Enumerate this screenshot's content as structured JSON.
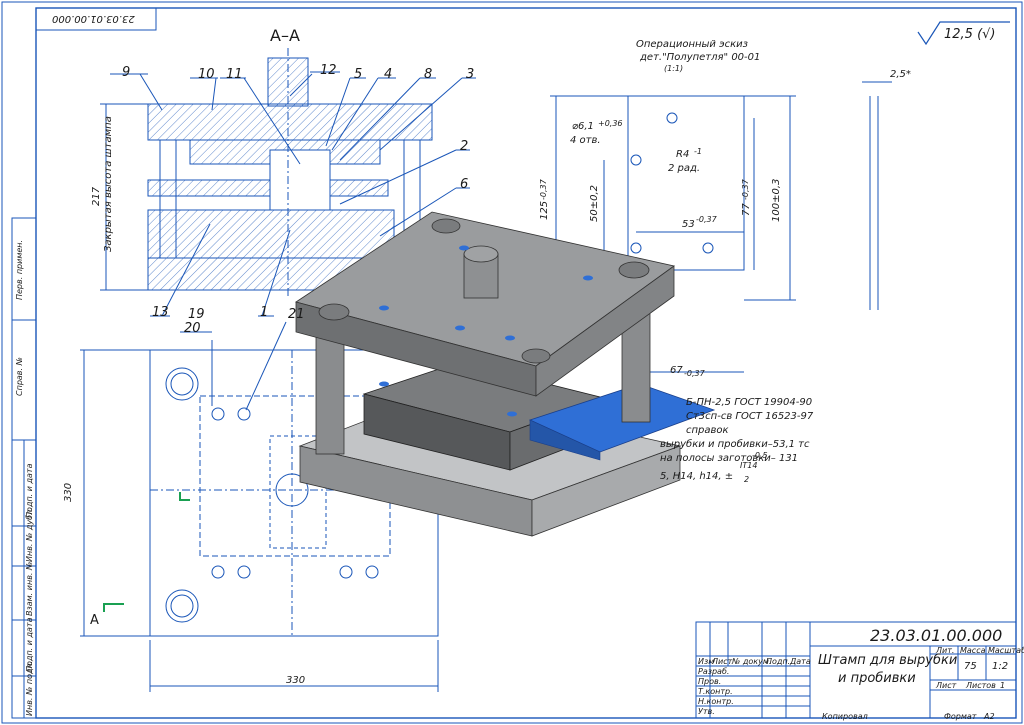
{
  "doc_number": "23.03.01.00.000",
  "doc_number_top_flipped": "23.03.01.00.000",
  "roughness": "12,5 (√)",
  "section_label": "A–A",
  "section_marker": "A",
  "sketch_title": "Операционный эскиз",
  "sketch_part": "дет.\"Полупетля\" 00-01",
  "sketch_scale": "(1:1)",
  "dimensions": {
    "hole_dia": "⌀6,1",
    "hole_dia_tol": "+0,36",
    "holes_count": "4 отв.",
    "radius": "R4",
    "radius_tol": "-1",
    "radius_count": "2 рад.",
    "height_125": "125",
    "height_125_tol": "-0,37",
    "dim_50": "50±0,2",
    "dim_53": "53",
    "dim_53_tol": "-0,37",
    "dim_77": "77",
    "dim_77_tol": "-0,37",
    "dim_100": "100±0,3",
    "dim_67": "67",
    "dim_67_tol": "-0,37",
    "dim_thickness": "2,5*",
    "dim_217": "217",
    "closed_height": "Закрытая высота штампа",
    "dim_330_v": "330",
    "dim_330_h": "330"
  },
  "part_numbers": [
    "9",
    "10",
    "11",
    "12",
    "5",
    "4",
    "8",
    "3",
    "2",
    "6",
    "13",
    "1",
    "19",
    "20",
    "21"
  ],
  "notes": [
    "Б-ПН-2,5 ГОСТ 19904-90",
    "Ст3сп-св ГОСТ 16523-97",
    "справок",
    "вырубки и пробивки–53,1 тс",
    "на полосы заготовки– 131",
    "5, H14, h14, ±"
  ],
  "note_tol": "-0,5",
  "note_it": "IT14",
  "note_it_den": "2",
  "title_block": {
    "number": "23.03.01.00.000",
    "name_line1": "Штамп для вырубки",
    "name_line2": "и пробивки",
    "col_izm": "Изм",
    "col_list": "Лист",
    "col_doc": "№ докум.",
    "col_sign": "Подп.",
    "col_date": "Дата",
    "razrab": "Разраб.",
    "prov": "Пров.",
    "tkontr": "Т.контр.",
    "nkontr": "Н.контр.",
    "utv": "Утв.",
    "lit": "Лит.",
    "massa": "Масса",
    "masshtab": "Масштаб",
    "mass_value": "75",
    "scale_value": "1:2",
    "sheet_label": "Лист",
    "sheets_label": "Листов",
    "sheets_value": "1",
    "copied": "Копировал",
    "format_label": "Формат",
    "format_value": "A2"
  },
  "side_strip": [
    "Перв. примен.",
    "Справ. №",
    "Подп. и дата",
    "Инв. № дубл.",
    "Взам. инв. №",
    "Подп. и дата",
    "Инв. № подл."
  ]
}
